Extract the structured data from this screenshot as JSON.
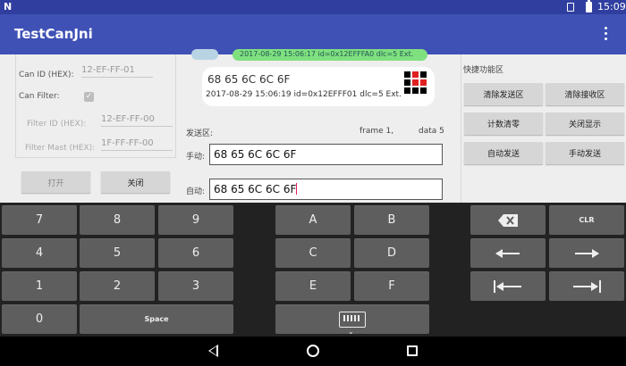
{
  "status_bar": {
    "notification_letter": "N",
    "time": "15:09"
  },
  "app_bar": {
    "title": "TestCanJni"
  },
  "settings": {
    "can_id_label": "Can ID (HEX):",
    "can_id_value": "12-EF-FF-01",
    "can_filter_label": "Can Filter:",
    "filter_id_label": "Filter ID (HEX):",
    "filter_id_value": "12-EF-FF-00",
    "filter_mask_label": "Filter Mast (HEX):",
    "filter_mask_value": "1F-FF-FF-00",
    "open_button": "打开",
    "close_button": "关闭"
  },
  "messages": {
    "top_partial": "2017-08-29 15:06:17 id=0x12EFFFA0 dlc=5 Ext.",
    "main_data": "68 65 6C 6C 6F",
    "main_meta": "2017-08-29 15:06:19 id=0x12EFFF01 dlc=5 Ext."
  },
  "send": {
    "section_label": "发送区:",
    "frame_info": "frame 1,",
    "data_info": "data 5",
    "manual_label": "手动:",
    "manual_value": "68 65 6C 6C 6F",
    "auto_label": "自动:",
    "auto_value": "68 65 6C 6C 6F"
  },
  "quick": {
    "title": "快捷功能区",
    "buttons": [
      "清除发送区",
      "清除接收区",
      "计数清零",
      "关闭显示",
      "自动发送",
      "手动发送"
    ]
  },
  "keyboard": {
    "digits": [
      "7",
      "8",
      "9",
      "4",
      "5",
      "6",
      "1",
      "2",
      "3",
      "0"
    ],
    "space": "Space",
    "letters": [
      "A",
      "B",
      "C",
      "D",
      "E",
      "F"
    ],
    "clear": "CLR",
    "icons": [
      "backspace-icon",
      "arrow-left-icon",
      "arrow-right-icon",
      "arrow-home-icon",
      "arrow-end-icon",
      "keyboard-hide-icon"
    ]
  },
  "colors": {
    "status_bar": "#303f9f",
    "app_bar": "#3f51b5",
    "bubble_green": "#7fe07f",
    "cursor": "#e91e63",
    "grid_red": "#e02020"
  },
  "nav_bar": {
    "icons": [
      "back-icon",
      "home-icon",
      "recents-icon"
    ]
  }
}
